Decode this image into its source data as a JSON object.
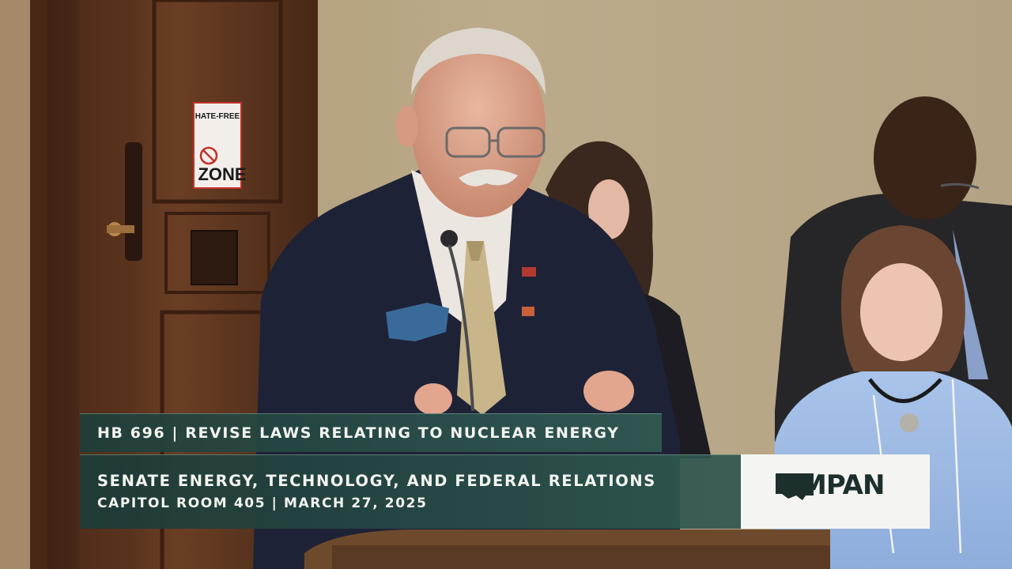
{
  "overlay": {
    "bill_line": "HB 696 | REVISE LAWS RELATING TO NUCLEAR ENERGY",
    "committee_line": "SENATE ENERGY, TECHNOLOGY, AND FEDERAL RELATIONS",
    "location_line": "CAPITOL ROOM 405 | MARCH 27, 2025",
    "logo_text": "MPAN"
  },
  "scene": {
    "door_sign_top": "HATE-FREE",
    "door_sign_bottom": "ZONE"
  },
  "colors": {
    "overlay_bg": "#1e3e3a",
    "overlay_text": "#f2f4f0",
    "wall": "#b9a98a",
    "door": "#5a3420",
    "logo_bg": "#f4f4f2",
    "logo_fg": "#1c2f2c"
  }
}
